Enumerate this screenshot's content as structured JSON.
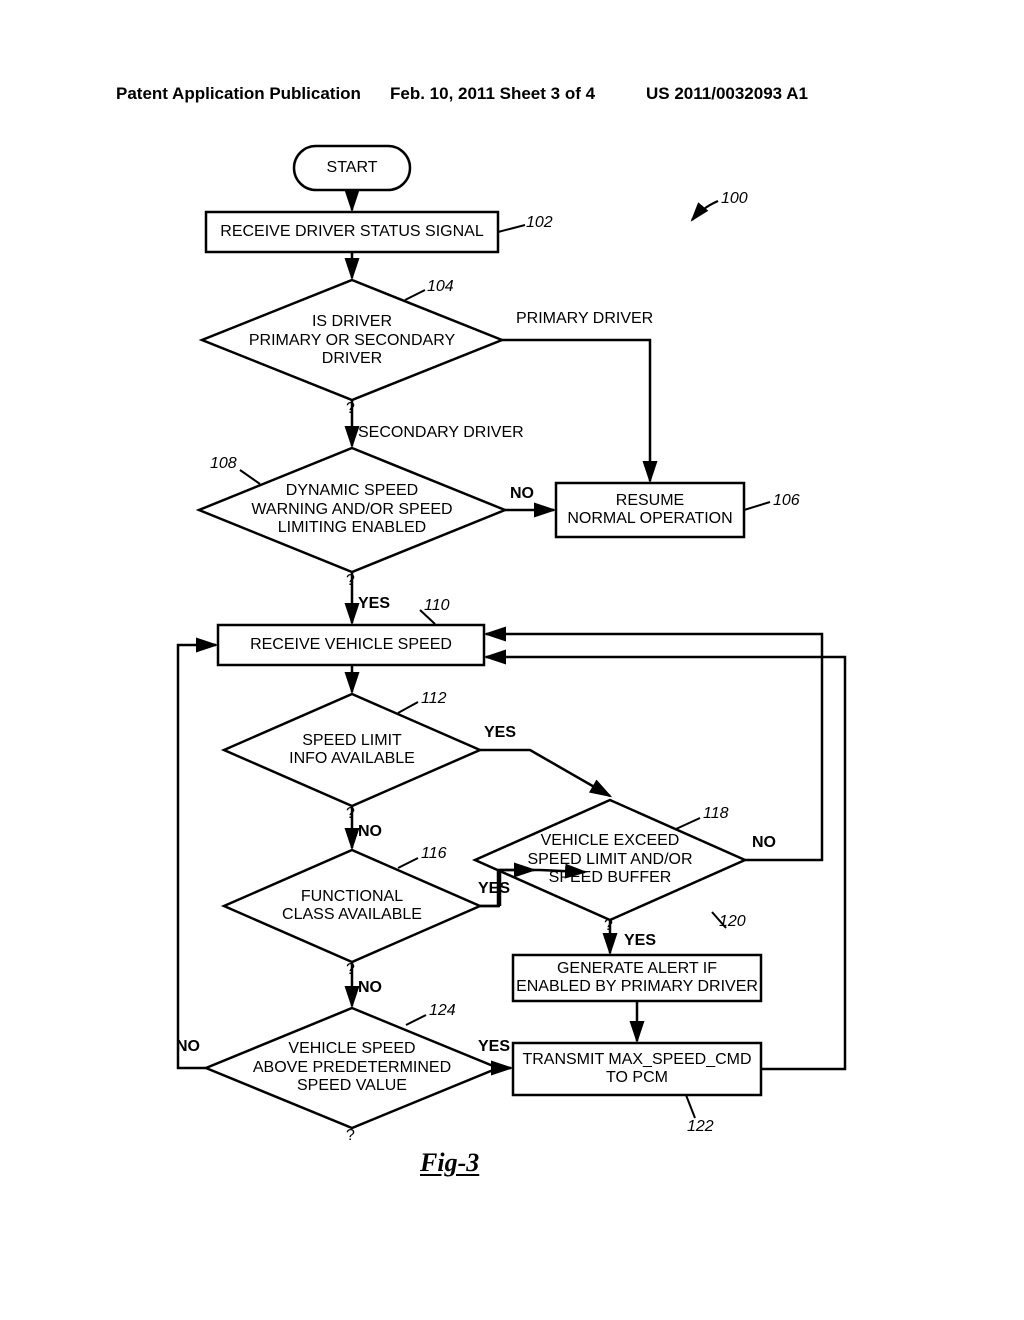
{
  "header": {
    "left": "Patent Application Publication",
    "center": "Feb. 10, 2011   Sheet 3 of 4",
    "right": "US 2011/0032093 A1"
  },
  "refs": {
    "r100": "100",
    "r102": "102",
    "r104": "104",
    "r106": "106",
    "r108": "108",
    "r110": "110",
    "r112": "112",
    "r116": "116",
    "r118": "118",
    "r120": "120",
    "r122": "122",
    "r124": "124"
  },
  "labels": {
    "start": "START",
    "receive_driver": "RECEIVE DRIVER STATUS SIGNAL",
    "driver_decision": "IS DRIVER\nPRIMARY OR SECONDARY\nDRIVER",
    "primary": "PRIMARY DRIVER",
    "secondary": "SECONDARY DRIVER",
    "speed_enable": "DYNAMIC SPEED\nWARNING AND/OR SPEED\nLIMITING ENABLED",
    "resume": "RESUME\nNORMAL OPERATION",
    "receive_speed": "RECEIVE VEHICLE SPEED",
    "speed_limit_avail": "SPEED LIMIT\nINFO AVAILABLE",
    "func_class": "FUNCTIONAL\nCLASS AVAILABLE",
    "speed_above": "VEHICLE SPEED\nABOVE PREDETERMINED\nSPEED VALUE",
    "vehicle_exceed": "VEHICLE EXCEED\nSPEED LIMIT AND/OR\nSPEED BUFFER",
    "generate_alert": "GENERATE ALERT IF\nENABLED BY PRIMARY DRIVER",
    "transmit": "TRANSMIT MAX_SPEED_CMD\nTO PCM",
    "yes": "YES",
    "no": "NO",
    "q": "?",
    "fig": "Fig-3"
  }
}
